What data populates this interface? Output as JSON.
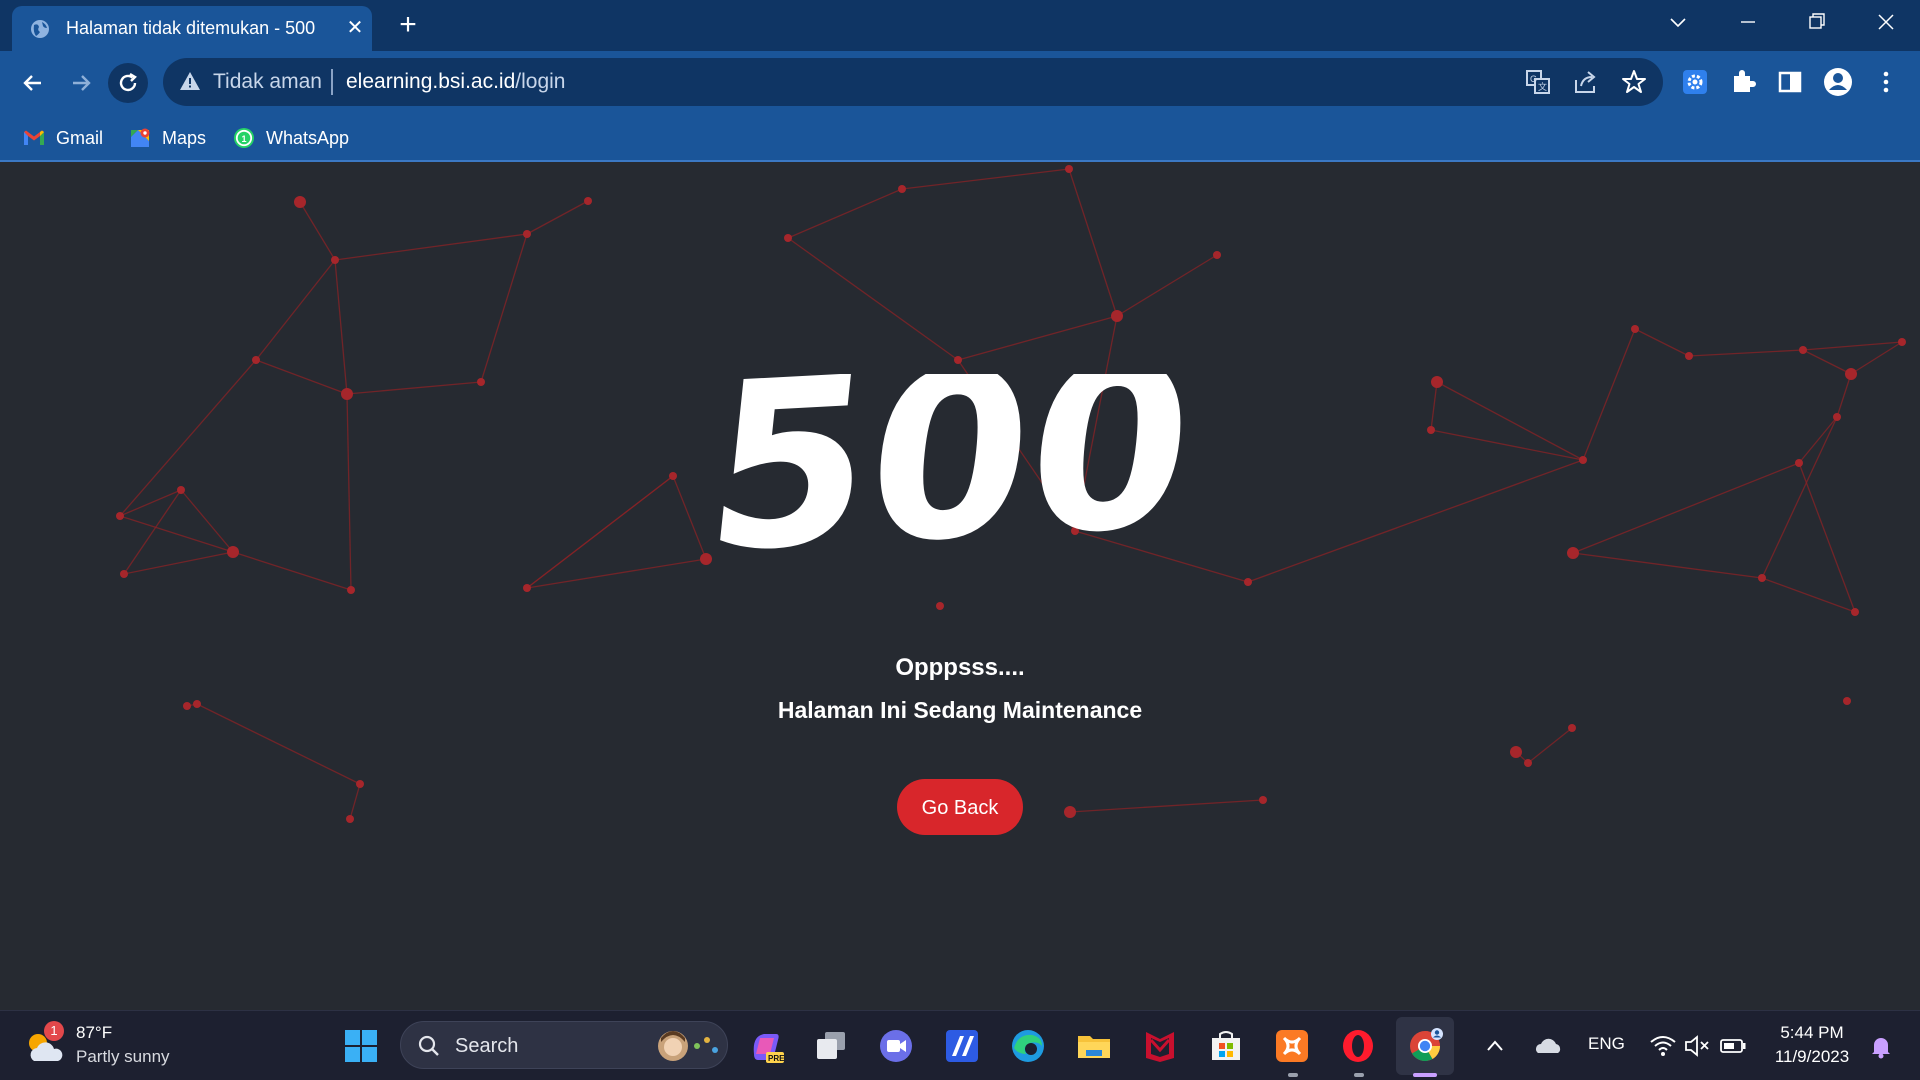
{
  "browser": {
    "tab_title": "Halaman tidak ditemukan - 500",
    "security_label": "Tidak aman",
    "url_domain": "elearning.bsi.ac.id",
    "url_path": "/login",
    "bookmarks": [
      {
        "label": "Gmail",
        "icon": "gmail-icon"
      },
      {
        "label": "Maps",
        "icon": "maps-icon"
      },
      {
        "label": "WhatsApp",
        "icon": "whatsapp-icon"
      }
    ]
  },
  "page": {
    "error_code": "500",
    "heading": "Opppsss....",
    "message": "Halaman Ini Sedang Maintenance",
    "button_label": "Go Back",
    "accent_color": "#d8262b",
    "background_color": "#262a31"
  },
  "taskbar": {
    "weather_temp": "87°F",
    "weather_condition": "Partly sunny",
    "weather_badge": "1",
    "search_label": "Search",
    "language": "ENG",
    "time": "5:44 PM",
    "date": "11/9/2023"
  },
  "colors": {
    "tab_strip": "#0f3564",
    "toolbar": "#1a5599",
    "taskbar": "#1d2030"
  }
}
